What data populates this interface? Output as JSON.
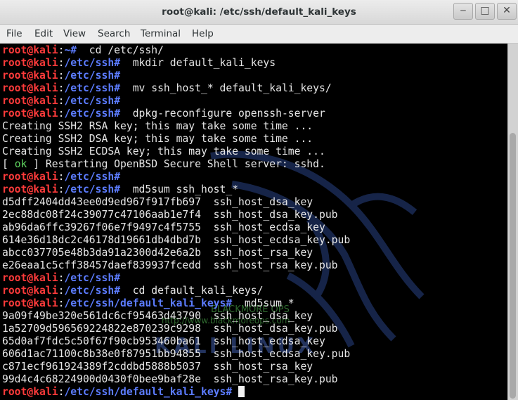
{
  "window": {
    "title": "root@kali: /etc/ssh/default_kali_keys",
    "minimize": "‒",
    "maximize": "□",
    "close": "✕"
  },
  "menu": [
    "File",
    "Edit",
    "View",
    "Search",
    "Terminal",
    "Help"
  ],
  "prompt": {
    "user": "root@kali",
    "sep": ":"
  },
  "lines": [
    {
      "type": "prompt",
      "path": "~",
      "cmd": "  cd /etc/ssh/"
    },
    {
      "type": "prompt",
      "path": "/etc/ssh",
      "cmd": "  mkdir default_kali_keys"
    },
    {
      "type": "prompt",
      "path": "/etc/ssh",
      "cmd": ""
    },
    {
      "type": "prompt",
      "path": "/etc/ssh",
      "cmd": "  mv ssh_host_* default_kali_keys/"
    },
    {
      "type": "prompt",
      "path": "/etc/ssh",
      "cmd": ""
    },
    {
      "type": "prompt",
      "path": "/etc/ssh",
      "cmd": "  dpkg-reconfigure openssh-server"
    },
    {
      "type": "text",
      "text": "Creating SSH2 RSA key; this may take some time ..."
    },
    {
      "type": "text",
      "text": "Creating SSH2 DSA key; this may take some time ..."
    },
    {
      "type": "text",
      "text": "Creating SSH2 ECDSA key; this may take some time ..."
    },
    {
      "type": "status",
      "pre": "[ ",
      "ok": "ok",
      "post": " ] Restarting OpenBSD Secure Shell server: sshd."
    },
    {
      "type": "prompt",
      "path": "/etc/ssh",
      "cmd": ""
    },
    {
      "type": "prompt",
      "path": "/etc/ssh",
      "cmd": "  md5sum ssh_host_*"
    },
    {
      "type": "text",
      "text": "d5dff2404dd43ee0d9ed967f917fb697  ssh_host_dsa_key"
    },
    {
      "type": "text",
      "text": "2ec88dc08f24c39077c47106aab1e7f4  ssh_host_dsa_key.pub"
    },
    {
      "type": "text",
      "text": "ab96da6ffc39267f06e7f9497c4f5755  ssh_host_ecdsa_key"
    },
    {
      "type": "text",
      "text": "614e36d18dc2c46178d19661db4dbd7b  ssh_host_ecdsa_key.pub"
    },
    {
      "type": "text",
      "text": "abcc037705e48b3da91a2300d42e6a2b  ssh_host_rsa_key"
    },
    {
      "type": "text",
      "text": "e26eaa1c5cff38457daef839937fcedd  ssh_host_rsa_key.pub"
    },
    {
      "type": "prompt",
      "path": "/etc/ssh",
      "cmd": ""
    },
    {
      "type": "prompt",
      "path": "/etc/ssh",
      "cmd": "  cd default_kali_keys/"
    },
    {
      "type": "prompt",
      "path": "/etc/ssh/default_kali_keys",
      "cmd": "  md5sum *"
    },
    {
      "type": "text",
      "text": "9a09f49be320e561dc6cf95463d43790  ssh_host_dsa_key"
    },
    {
      "type": "text",
      "text": "1a52709d596569224822e870239c9298  ssh_host_dsa_key.pub"
    },
    {
      "type": "text",
      "text": "65d0af7fdc5c50f67f90cb953460ba61  ssh_host_ecdsa_key"
    },
    {
      "type": "text",
      "text": "606d1ac71100c8b38e0f87951bb94855  ssh_host_ecdsa_key.pub"
    },
    {
      "type": "text",
      "text": "c871ecf961924389f2cddbd5888b5037  ssh_host_rsa_key"
    },
    {
      "type": "text",
      "text": "99d4c4c68224900d0430f0bee9baf28e  ssh_host_rsa_key.pub"
    },
    {
      "type": "prompt",
      "path": "/etc/ssh/default_kali_keys",
      "cmd": " ",
      "cursor": true
    }
  ],
  "watermark": {
    "line1": "BLACKMORE OPS",
    "line2": "http://www.blackmoreops.com",
    "line3": "KALI LINUX"
  },
  "colors": {
    "user": "#ff3b3b",
    "path": "#5c7cff",
    "ok": "#5fd35f",
    "text": "#e6e6e6",
    "bg": "#000000"
  }
}
